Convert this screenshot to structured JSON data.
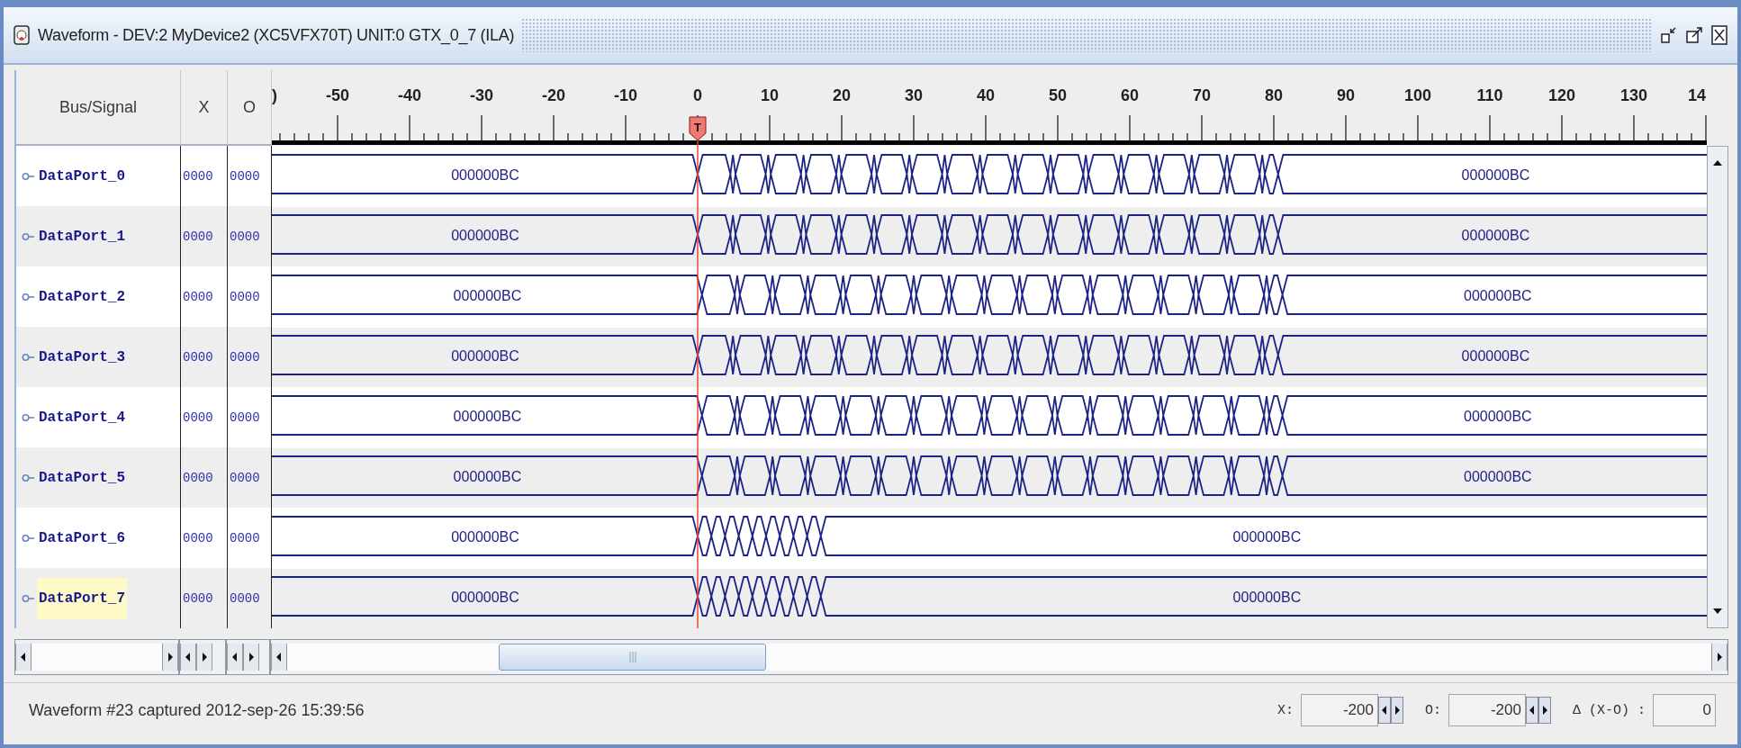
{
  "window": {
    "title": "Waveform - DEV:2 MyDevice2 (XC5VFX70T) UNIT:0 GTX_0_7 (ILA)"
  },
  "columns": [
    "Bus/Signal",
    "X",
    "O"
  ],
  "ruler": {
    "labels": [
      ")",
      "-50",
      "-40",
      "-30",
      "-20",
      "-10",
      "0",
      "10",
      "20",
      "30",
      "40",
      "50",
      "60",
      "70",
      "80",
      "90",
      "100",
      "110",
      "120",
      "130",
      "14"
    ],
    "trigger_marker": "T"
  },
  "signals": [
    {
      "name": "DataPort_0",
      "x_value": "0000",
      "o_value": "0000",
      "selected": false,
      "kind": "long",
      "left_value": "000000BC",
      "right_value": "000000BC"
    },
    {
      "name": "DataPort_1",
      "x_value": "0000",
      "o_value": "0000",
      "selected": false,
      "kind": "long",
      "left_value": "000000BC",
      "right_value": "000000BC"
    },
    {
      "name": "DataPort_2",
      "x_value": "0000",
      "o_value": "0000",
      "selected": false,
      "kind": "long-late",
      "left_value": "000000BC",
      "right_value": "000000BC"
    },
    {
      "name": "DataPort_3",
      "x_value": "0000",
      "o_value": "0000",
      "selected": false,
      "kind": "long",
      "left_value": "000000BC",
      "right_value": "000000BC"
    },
    {
      "name": "DataPort_4",
      "x_value": "0000",
      "o_value": "0000",
      "selected": false,
      "kind": "long-late",
      "left_value": "000000BC",
      "right_value": "000000BC"
    },
    {
      "name": "DataPort_5",
      "x_value": "0000",
      "o_value": "0000",
      "selected": false,
      "kind": "long-late",
      "left_value": "000000BC",
      "right_value": "000000BC"
    },
    {
      "name": "DataPort_6",
      "x_value": "0000",
      "o_value": "0000",
      "selected": false,
      "kind": "short",
      "left_value": "000000BC",
      "right_value": "000000BC"
    },
    {
      "name": "DataPort_7",
      "x_value": "0000",
      "o_value": "0000",
      "selected": true,
      "kind": "short",
      "left_value": "000000BC",
      "right_value": "000000BC"
    }
  ],
  "status_bar": {
    "message": "Waveform #23 captured 2012-sep-26 15:39:56",
    "x_label": "X:",
    "x_value": "-200",
    "o_label": "O:",
    "o_value": "-200",
    "delta_label": "Δ (X-O) :",
    "delta_value": "0"
  }
}
